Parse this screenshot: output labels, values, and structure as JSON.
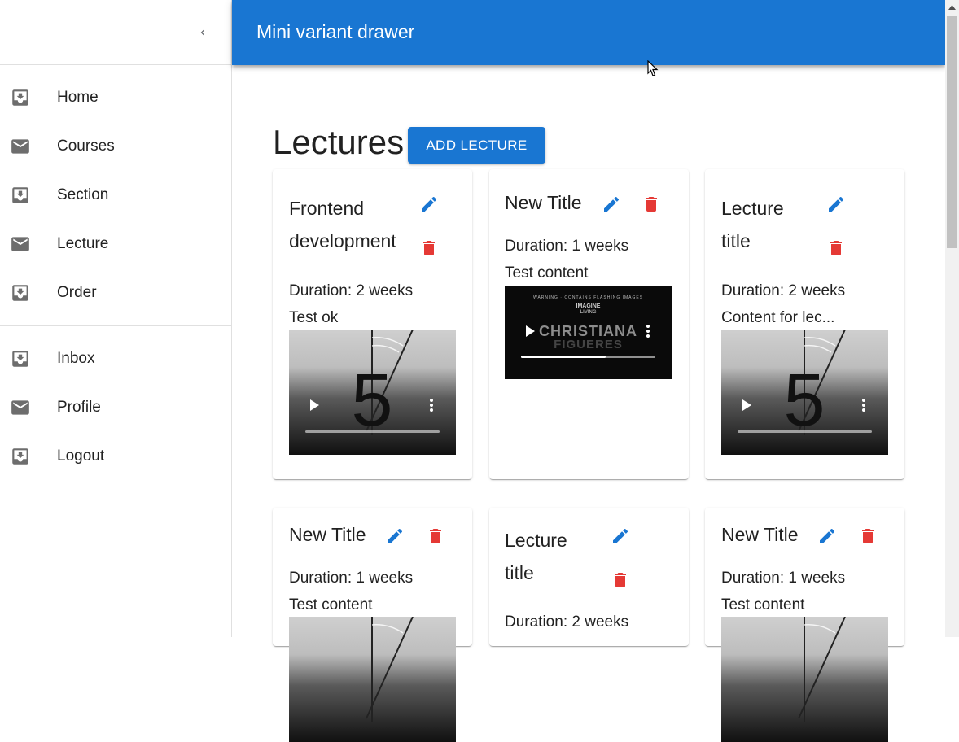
{
  "appbar": {
    "title": "Mini variant drawer"
  },
  "drawer": {
    "primary": [
      {
        "label": "Home",
        "icon": "inbox-download-icon"
      },
      {
        "label": "Courses",
        "icon": "mail-icon"
      },
      {
        "label": "Section",
        "icon": "inbox-download-icon"
      },
      {
        "label": "Lecture",
        "icon": "mail-icon"
      },
      {
        "label": "Order",
        "icon": "inbox-download-icon"
      }
    ],
    "secondary": [
      {
        "label": "Inbox",
        "icon": "inbox-download-icon"
      },
      {
        "label": "Profile",
        "icon": "mail-icon"
      },
      {
        "label": "Logout",
        "icon": "inbox-download-icon"
      }
    ]
  },
  "main": {
    "title": "Lectures",
    "add_button": "ADD LECTURE",
    "cards": [
      {
        "title_line1": "Frontend",
        "title_line2": "development",
        "duration": "Duration: 2 weeks",
        "content": "Test ok",
        "video": "countdown"
      },
      {
        "title_line1": "New Title",
        "title_line2": "",
        "duration": "Duration: 1 weeks",
        "content": "Test content",
        "video": "dark",
        "video_text": {
          "warning": "WARNING · CONTAINS FLASHING IMAGES",
          "brand_top": "IMAGINE",
          "brand_bottom": "LIVING",
          "name_line1": "CHRISTIANA",
          "name_line2": "FIGUERES"
        }
      },
      {
        "title_line1": "Lecture",
        "title_line2": "title",
        "duration": "Duration: 2 weeks",
        "content": "Content for lec...",
        "video": "countdown"
      },
      {
        "title_line1": "New Title",
        "title_line2": "",
        "duration": "Duration: 1 weeks",
        "content": "Test content",
        "video": "countdown"
      },
      {
        "title_line1": "Lecture",
        "title_line2": "title",
        "duration": "Duration: 2 weeks",
        "content": "",
        "video": "none"
      },
      {
        "title_line1": "New Title",
        "title_line2": "",
        "duration": "Duration: 1 weeks",
        "content": "Test content",
        "video": "countdown"
      }
    ],
    "countdown_digit": "5"
  },
  "colors": {
    "primary": "#1976d2",
    "edit": "#1976d2",
    "delete": "#e53935"
  }
}
